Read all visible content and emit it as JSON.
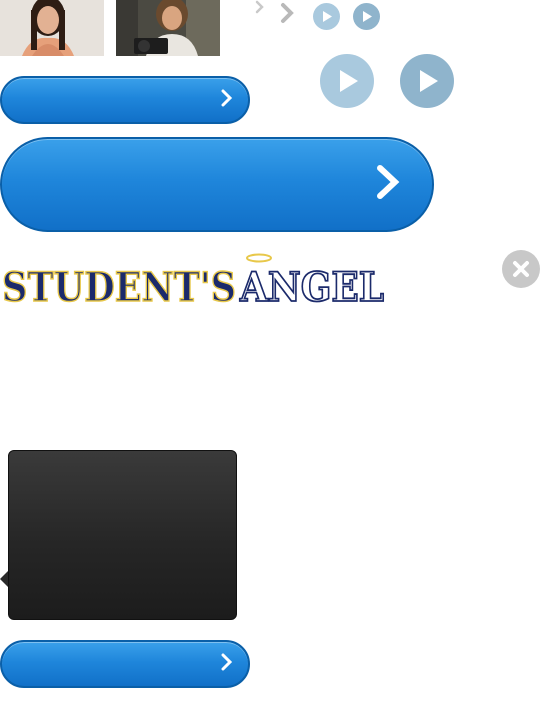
{
  "photos": [
    {
      "name": "woman-portrait-photo"
    },
    {
      "name": "woman-with-camera-photo"
    }
  ],
  "buttons": {
    "top_label": "",
    "big_label": "",
    "bottom_label": ""
  },
  "logo": {
    "text_part1": "STUDENT'S",
    "text_part2": "ANGEL"
  },
  "tooltip": {
    "text": ""
  },
  "colors": {
    "button_blue": "#1f86db",
    "play_light": "#a9c9de",
    "play_dark": "#8fb4cc",
    "logo_navy": "#1b2a6b",
    "logo_gold": "#e8c84a",
    "close_gray": "#c8c8c8",
    "tooltip_dark": "#262626"
  }
}
